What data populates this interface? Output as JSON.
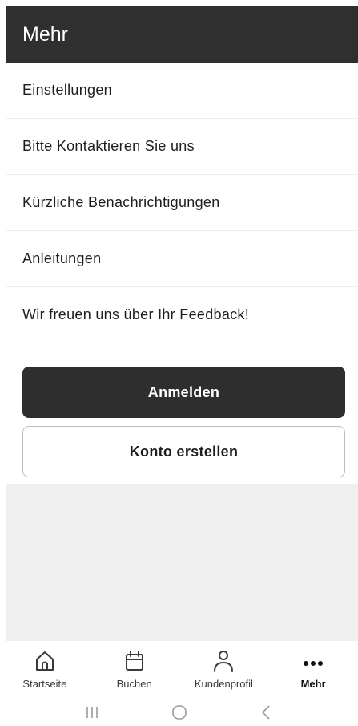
{
  "header": {
    "title": "Mehr"
  },
  "menu": {
    "items": [
      {
        "label": "Einstellungen"
      },
      {
        "label": "Bitte Kontaktieren Sie uns"
      },
      {
        "label": "Kürzliche Benachrichtigungen"
      },
      {
        "label": "Anleitungen"
      },
      {
        "label": "Wir freuen uns über Ihr Feedback!"
      }
    ]
  },
  "actions": {
    "login_label": "Anmelden",
    "create_account_label": "Konto erstellen"
  },
  "tabbar": {
    "tabs": [
      {
        "label": "Startseite",
        "icon": "home-icon"
      },
      {
        "label": "Buchen",
        "icon": "calendar-icon"
      },
      {
        "label": "Kundenprofil",
        "icon": "person-icon"
      },
      {
        "label": "Mehr",
        "icon": "more-dots-icon",
        "active": true
      }
    ]
  },
  "colors": {
    "header_bg": "#2f2f2f",
    "primary_button": "#2e2e2e",
    "gray_area": "#efefef"
  }
}
